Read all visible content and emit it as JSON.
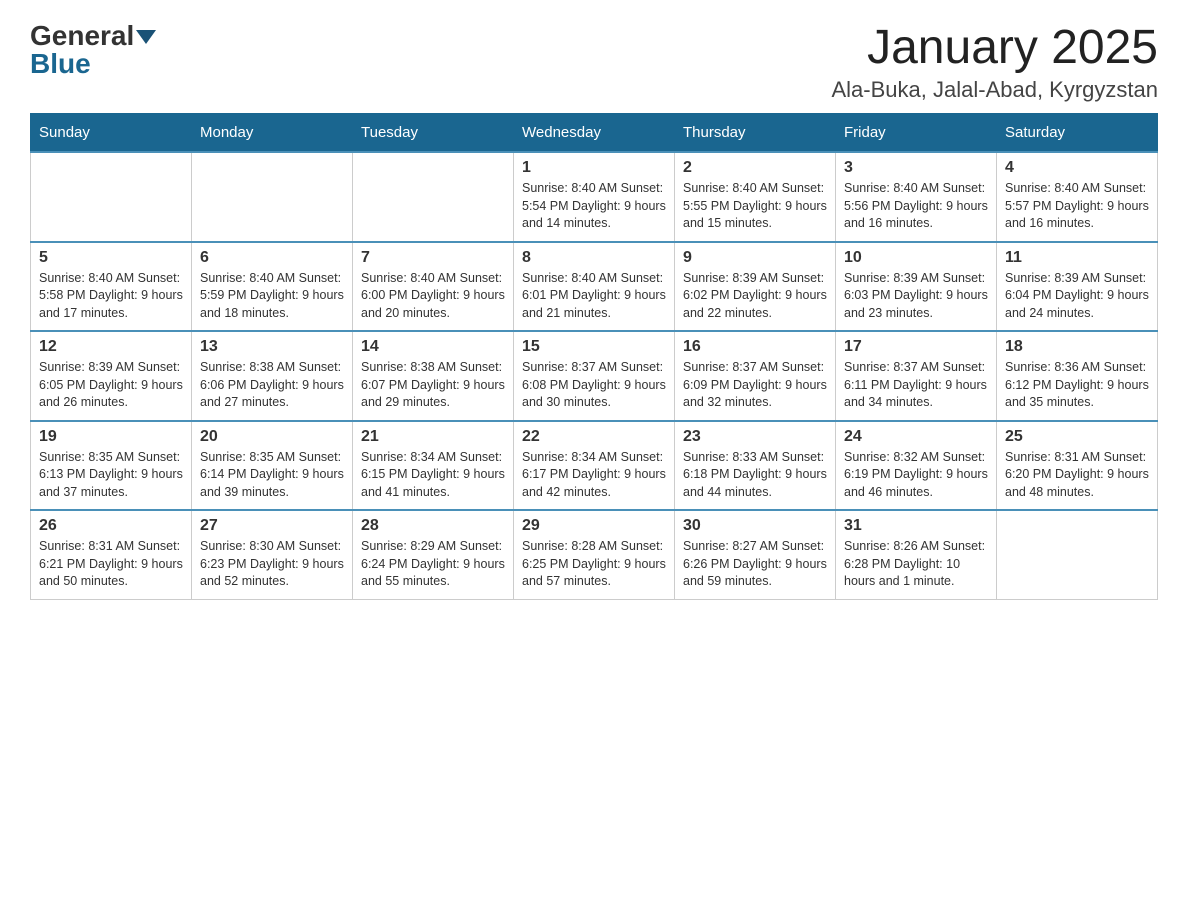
{
  "header": {
    "logo_general": "General",
    "logo_blue": "Blue",
    "month_title": "January 2025",
    "location": "Ala-Buka, Jalal-Abad, Kyrgyzstan"
  },
  "days_of_week": [
    "Sunday",
    "Monday",
    "Tuesday",
    "Wednesday",
    "Thursday",
    "Friday",
    "Saturday"
  ],
  "weeks": [
    {
      "days": [
        {
          "num": "",
          "info": ""
        },
        {
          "num": "",
          "info": ""
        },
        {
          "num": "",
          "info": ""
        },
        {
          "num": "1",
          "info": "Sunrise: 8:40 AM\nSunset: 5:54 PM\nDaylight: 9 hours\nand 14 minutes."
        },
        {
          "num": "2",
          "info": "Sunrise: 8:40 AM\nSunset: 5:55 PM\nDaylight: 9 hours\nand 15 minutes."
        },
        {
          "num": "3",
          "info": "Sunrise: 8:40 AM\nSunset: 5:56 PM\nDaylight: 9 hours\nand 16 minutes."
        },
        {
          "num": "4",
          "info": "Sunrise: 8:40 AM\nSunset: 5:57 PM\nDaylight: 9 hours\nand 16 minutes."
        }
      ]
    },
    {
      "days": [
        {
          "num": "5",
          "info": "Sunrise: 8:40 AM\nSunset: 5:58 PM\nDaylight: 9 hours\nand 17 minutes."
        },
        {
          "num": "6",
          "info": "Sunrise: 8:40 AM\nSunset: 5:59 PM\nDaylight: 9 hours\nand 18 minutes."
        },
        {
          "num": "7",
          "info": "Sunrise: 8:40 AM\nSunset: 6:00 PM\nDaylight: 9 hours\nand 20 minutes."
        },
        {
          "num": "8",
          "info": "Sunrise: 8:40 AM\nSunset: 6:01 PM\nDaylight: 9 hours\nand 21 minutes."
        },
        {
          "num": "9",
          "info": "Sunrise: 8:39 AM\nSunset: 6:02 PM\nDaylight: 9 hours\nand 22 minutes."
        },
        {
          "num": "10",
          "info": "Sunrise: 8:39 AM\nSunset: 6:03 PM\nDaylight: 9 hours\nand 23 minutes."
        },
        {
          "num": "11",
          "info": "Sunrise: 8:39 AM\nSunset: 6:04 PM\nDaylight: 9 hours\nand 24 minutes."
        }
      ]
    },
    {
      "days": [
        {
          "num": "12",
          "info": "Sunrise: 8:39 AM\nSunset: 6:05 PM\nDaylight: 9 hours\nand 26 minutes."
        },
        {
          "num": "13",
          "info": "Sunrise: 8:38 AM\nSunset: 6:06 PM\nDaylight: 9 hours\nand 27 minutes."
        },
        {
          "num": "14",
          "info": "Sunrise: 8:38 AM\nSunset: 6:07 PM\nDaylight: 9 hours\nand 29 minutes."
        },
        {
          "num": "15",
          "info": "Sunrise: 8:37 AM\nSunset: 6:08 PM\nDaylight: 9 hours\nand 30 minutes."
        },
        {
          "num": "16",
          "info": "Sunrise: 8:37 AM\nSunset: 6:09 PM\nDaylight: 9 hours\nand 32 minutes."
        },
        {
          "num": "17",
          "info": "Sunrise: 8:37 AM\nSunset: 6:11 PM\nDaylight: 9 hours\nand 34 minutes."
        },
        {
          "num": "18",
          "info": "Sunrise: 8:36 AM\nSunset: 6:12 PM\nDaylight: 9 hours\nand 35 minutes."
        }
      ]
    },
    {
      "days": [
        {
          "num": "19",
          "info": "Sunrise: 8:35 AM\nSunset: 6:13 PM\nDaylight: 9 hours\nand 37 minutes."
        },
        {
          "num": "20",
          "info": "Sunrise: 8:35 AM\nSunset: 6:14 PM\nDaylight: 9 hours\nand 39 minutes."
        },
        {
          "num": "21",
          "info": "Sunrise: 8:34 AM\nSunset: 6:15 PM\nDaylight: 9 hours\nand 41 minutes."
        },
        {
          "num": "22",
          "info": "Sunrise: 8:34 AM\nSunset: 6:17 PM\nDaylight: 9 hours\nand 42 minutes."
        },
        {
          "num": "23",
          "info": "Sunrise: 8:33 AM\nSunset: 6:18 PM\nDaylight: 9 hours\nand 44 minutes."
        },
        {
          "num": "24",
          "info": "Sunrise: 8:32 AM\nSunset: 6:19 PM\nDaylight: 9 hours\nand 46 minutes."
        },
        {
          "num": "25",
          "info": "Sunrise: 8:31 AM\nSunset: 6:20 PM\nDaylight: 9 hours\nand 48 minutes."
        }
      ]
    },
    {
      "days": [
        {
          "num": "26",
          "info": "Sunrise: 8:31 AM\nSunset: 6:21 PM\nDaylight: 9 hours\nand 50 minutes."
        },
        {
          "num": "27",
          "info": "Sunrise: 8:30 AM\nSunset: 6:23 PM\nDaylight: 9 hours\nand 52 minutes."
        },
        {
          "num": "28",
          "info": "Sunrise: 8:29 AM\nSunset: 6:24 PM\nDaylight: 9 hours\nand 55 minutes."
        },
        {
          "num": "29",
          "info": "Sunrise: 8:28 AM\nSunset: 6:25 PM\nDaylight: 9 hours\nand 57 minutes."
        },
        {
          "num": "30",
          "info": "Sunrise: 8:27 AM\nSunset: 6:26 PM\nDaylight: 9 hours\nand 59 minutes."
        },
        {
          "num": "31",
          "info": "Sunrise: 8:26 AM\nSunset: 6:28 PM\nDaylight: 10 hours\nand 1 minute."
        },
        {
          "num": "",
          "info": ""
        }
      ]
    }
  ]
}
